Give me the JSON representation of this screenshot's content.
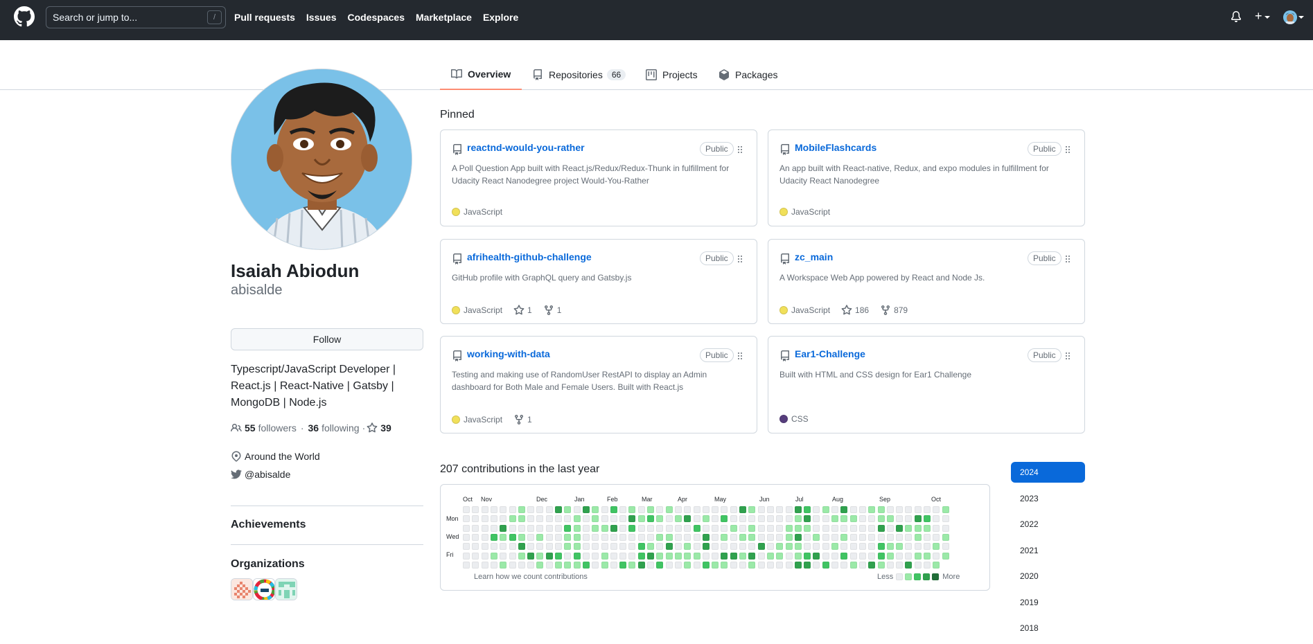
{
  "topnav": {
    "search_placeholder": "Search or jump to...",
    "search_key": "/",
    "links": [
      "Pull requests",
      "Issues",
      "Codespaces",
      "Marketplace",
      "Explore"
    ],
    "plus_label": "+"
  },
  "tabs": [
    {
      "label": "Overview",
      "icon": "book-icon",
      "selected": true
    },
    {
      "label": "Repositories",
      "icon": "repo-icon",
      "count": "66"
    },
    {
      "label": "Projects",
      "icon": "project-icon"
    },
    {
      "label": "Packages",
      "icon": "package-icon"
    }
  ],
  "profile": {
    "fullname": "Isaiah Abiodun",
    "username": "abisalde",
    "follow_label": "Follow",
    "bio": "Typescript/JavaScript Developer | React.js | React-Native | Gatsby | MongoDB | Node.js",
    "followers_count": "55",
    "followers_label": "followers",
    "following_count": "36",
    "following_label": "following",
    "separator": "·",
    "stars_count": "39",
    "location": "Around the World",
    "twitter": "@abisalde",
    "achievements_label": "Achievements",
    "organizations_label": "Organizations"
  },
  "pinned": {
    "title": "Pinned",
    "cards": [
      {
        "name": "reactnd-would-you-rather",
        "badge": "Public",
        "desc": "A Poll Question App built with React.js/Redux/Redux-Thunk in fulfillment for Udacity React Nanodegree project Would-You-Rather",
        "lang": "JavaScript",
        "lang_color": "#f1e05a",
        "stars": "",
        "forks": ""
      },
      {
        "name": "MobileFlashcards",
        "badge": "Public",
        "desc": "An app built with React-native, Redux, and expo modules in fulfillment for Udacity React Nanodegree",
        "lang": "JavaScript",
        "lang_color": "#f1e05a",
        "stars": "",
        "forks": ""
      },
      {
        "name": "afrihealth-github-challenge",
        "badge": "Public",
        "desc": "GitHub profile with GraphQL query and Gatsby.js",
        "lang": "JavaScript",
        "lang_color": "#f1e05a",
        "stars": "1",
        "forks": "1"
      },
      {
        "name": "zc_main",
        "badge": "Public",
        "desc": "A Workspace Web App powered by React and Node Js.",
        "lang": "JavaScript",
        "lang_color": "#f1e05a",
        "stars": "186",
        "forks": "879"
      },
      {
        "name": "working-with-data",
        "badge": "Public",
        "desc": "Testing and making use of RandomUser RestAPI to display an Admin dashboard for Both Male and Female Users. Built with React.js",
        "lang": "JavaScript",
        "lang_color": "#f1e05a",
        "stars": "",
        "forks": "1"
      },
      {
        "name": "Ear1-Challenge",
        "badge": "Public",
        "desc": "Built with HTML and CSS design for Ear1 Challenge",
        "lang": "CSS",
        "lang_color": "#563d7c",
        "stars": "",
        "forks": ""
      }
    ]
  },
  "contributions": {
    "title": "207 contributions in the last year",
    "months": [
      "Oct",
      "Nov",
      "Dec",
      "Jan",
      "Feb",
      "Mar",
      "Apr",
      "May",
      "Jun",
      "Jul",
      "Aug",
      "Sep",
      "Oct"
    ],
    "days": [
      "Mon",
      "Wed",
      "Fri"
    ],
    "learn_label": "Learn how we count contributions",
    "less_label": "Less",
    "more_label": "More",
    "colors": [
      "#ebedf0",
      "#9be9a8",
      "#40c463",
      "#30a14e",
      "#216e39"
    ],
    "years": [
      "2024",
      "2023",
      "2022",
      "2021",
      "2020",
      "2019",
      "2018"
    ]
  }
}
